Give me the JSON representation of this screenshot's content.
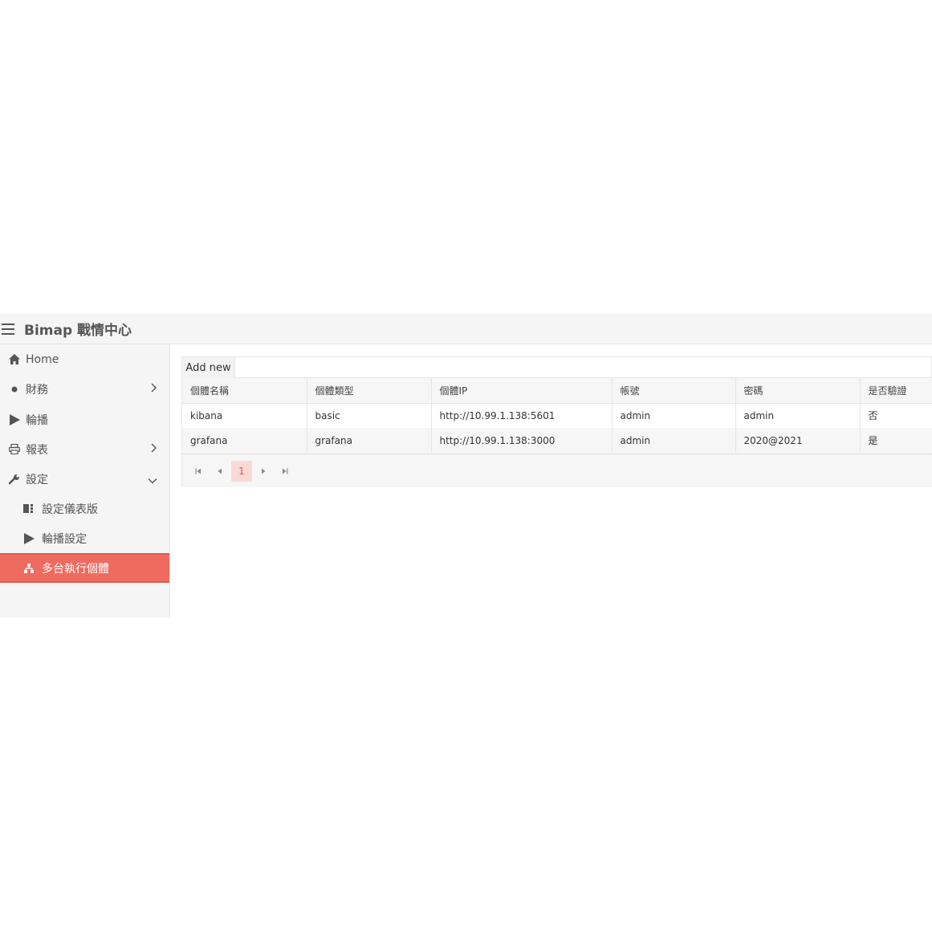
{
  "app": {
    "title": "Bimap 戰情中心"
  },
  "sidebar": {
    "items": [
      {
        "label": "Home",
        "icon": "home-icon"
      },
      {
        "label": "財務",
        "icon": "dot-icon",
        "expandable": true
      },
      {
        "label": "輪播",
        "icon": "play-icon"
      },
      {
        "label": "報表",
        "icon": "printer-icon",
        "expandable": true
      },
      {
        "label": "設定",
        "icon": "wrench-icon",
        "expanded": true
      },
      {
        "label": "設定儀表版",
        "icon": "dashboard-icon",
        "sub": true
      },
      {
        "label": "輪播設定",
        "icon": "play-icon",
        "sub": true
      },
      {
        "label": "多台執行個體",
        "icon": "sitemap-icon",
        "sub": true,
        "active": true
      }
    ]
  },
  "grid": {
    "add_label": "Add new",
    "columns": [
      "個體名稱",
      "個體類型",
      "個體IP",
      "帳號",
      "密碼",
      "是否驗證"
    ],
    "rows": [
      [
        "kibana",
        "basic",
        "http://10.99.1.138:5601",
        "admin",
        "admin",
        "否"
      ],
      [
        "grafana",
        "grafana",
        "http://10.99.1.138:3000",
        "admin",
        "2020@2021",
        "是"
      ]
    ],
    "pager": {
      "current_page": "1"
    }
  },
  "colors": {
    "accent": "#ef6b5f",
    "accent_light": "#f9d9d6"
  }
}
